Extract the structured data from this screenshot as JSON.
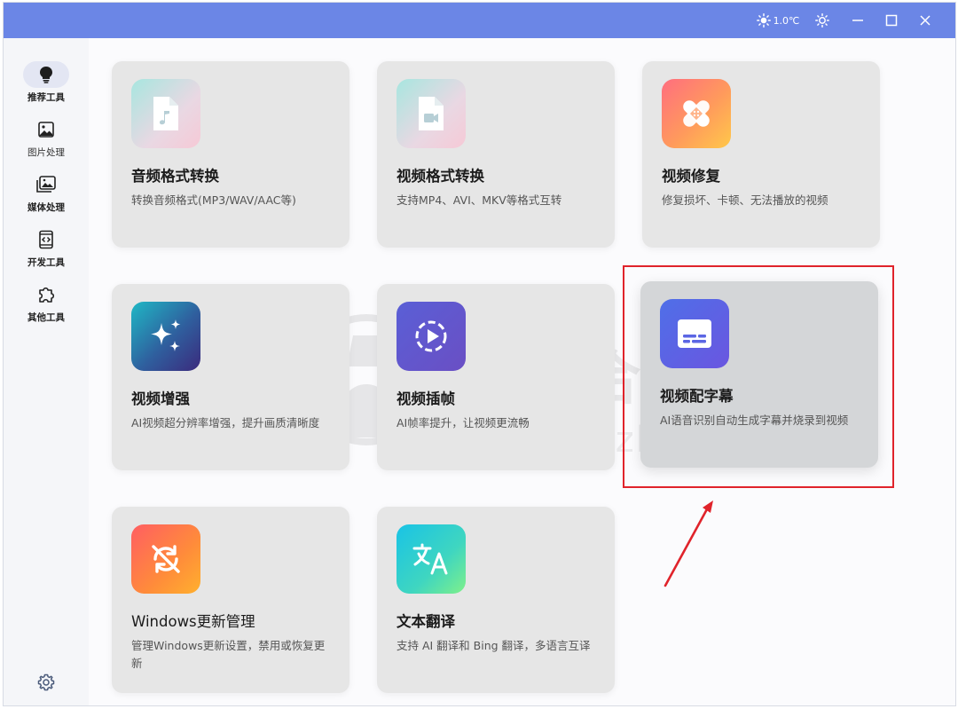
{
  "titlebar": {
    "weather_temp": "1.0℃",
    "icons": [
      "sun-icon",
      "theme-icon",
      "minimize-icon",
      "maximize-icon",
      "close-icon"
    ]
  },
  "sidebar": {
    "items": [
      {
        "label": "推荐工具",
        "icon": "lightbulb-icon",
        "active": true
      },
      {
        "label": "图片处理",
        "icon": "image-icon",
        "active": false
      },
      {
        "label": "媒体处理",
        "icon": "media-icon",
        "active": false
      },
      {
        "label": "开发工具",
        "icon": "code-icon",
        "active": false
      },
      {
        "label": "其他工具",
        "icon": "puzzle-icon",
        "active": false
      }
    ],
    "settings_icon": "gear-icon"
  },
  "cards": [
    {
      "title": "音频格式转换",
      "desc": "转换音频格式(MP3/WAV/AAC等)",
      "icon": "audio-file-icon"
    },
    {
      "title": "视频格式转换",
      "desc": "支持MP4、AVI、MKV等格式互转",
      "icon": "video-file-icon"
    },
    {
      "title": "视频修复",
      "desc": "修复损坏、卡顿、无法播放的视频",
      "icon": "bandage-icon"
    },
    {
      "title": "视频增强",
      "desc": "AI视频超分辨率增强，提升画质清晰度",
      "icon": "sparkle-icon"
    },
    {
      "title": "视频插帧",
      "desc": "AI帧率提升，让视频更流畅",
      "icon": "play-circle-icon"
    },
    {
      "title": "视频配字幕",
      "desc": "AI语音识别自动生成字幕并烧录到视频",
      "icon": "subtitle-icon"
    },
    {
      "title": "Windows更新管理",
      "desc": "管理Windows更新设置，禁用或恢复更新",
      "icon": "sync-off-icon"
    },
    {
      "title": "文本翻译",
      "desc": "支持 AI 翻译和 Bing 翻译，多语言互译",
      "icon": "translate-icon"
    }
  ],
  "watermark": {
    "text": "i3综合社区",
    "url": "www.i3zh.com"
  },
  "colors": {
    "titlebar": "#6b86e6",
    "highlight": "#e0232b",
    "card_bg": "#e6e6e6"
  }
}
